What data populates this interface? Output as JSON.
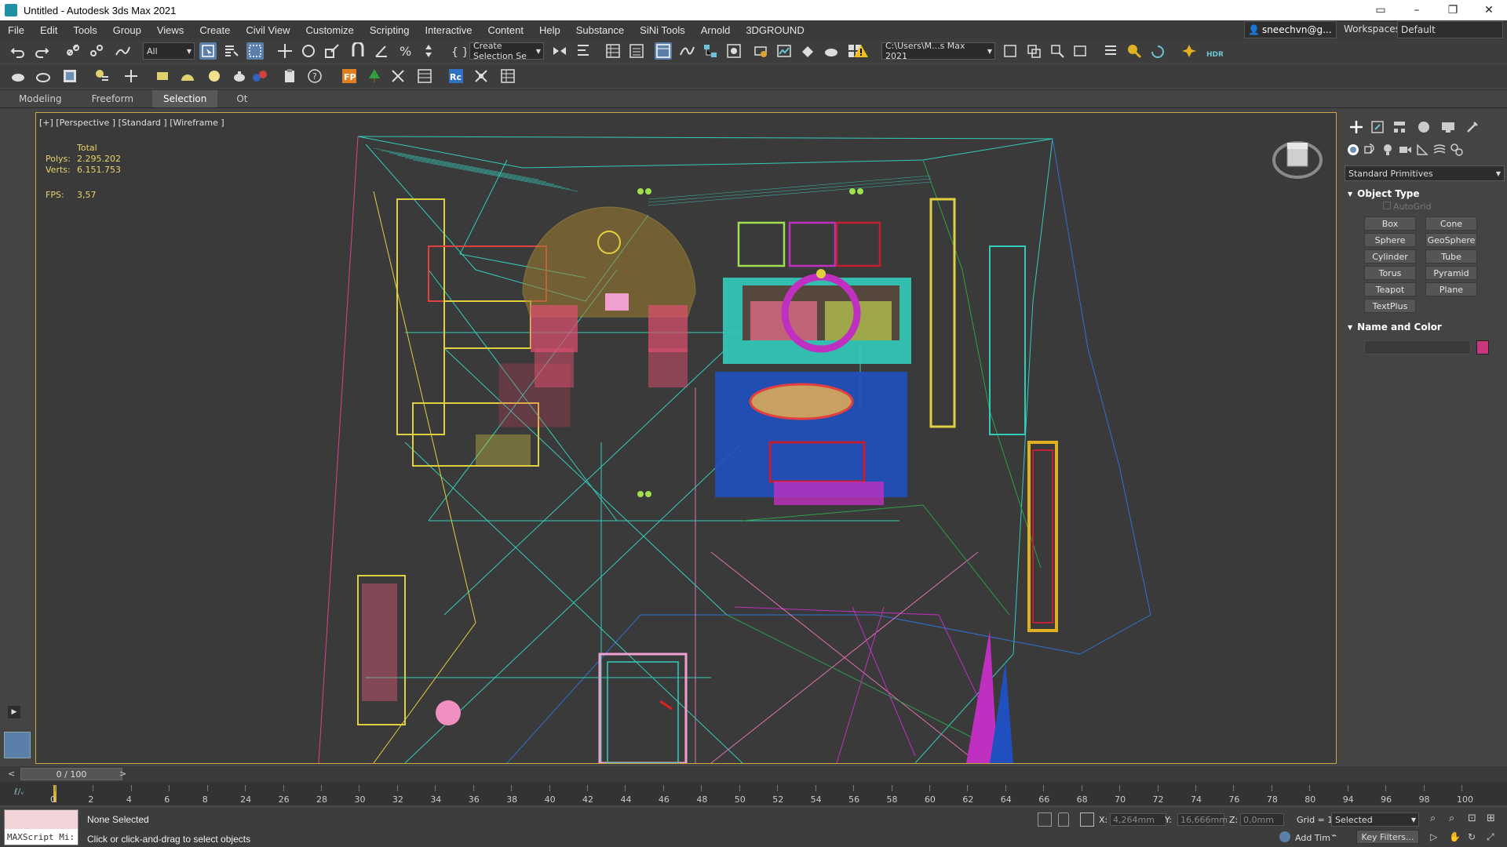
{
  "window": {
    "title": "Untitled - Autodesk 3ds Max 2021"
  },
  "menu": [
    "File",
    "Edit",
    "Tools",
    "Group",
    "Views",
    "Create",
    "Civil View",
    "Customize",
    "Scripting",
    "Interactive",
    "Content",
    "Help",
    "Substance",
    "SiNi Tools",
    "Arnold",
    "3DGROUND"
  ],
  "account": {
    "user": "sneechvn@g...",
    "workspaces_label": "Workspaces:",
    "workspace": "Default"
  },
  "toolbar": {
    "selection_filter": "All",
    "selection_set": "Create Selection Se",
    "project_path": "C:\\Users\\M...s Max 2021"
  },
  "ribbon": {
    "tabs": [
      "Modeling",
      "Freeform",
      "Selection",
      "Ot"
    ],
    "active": "Selection"
  },
  "viewport": {
    "label": "[+] [Perspective ] [Standard ] [Wireframe ]",
    "stats": {
      "header": "Total",
      "polys_label": "Polys:",
      "polys": "2.295.202",
      "verts_label": "Verts:",
      "verts": "6.151.753",
      "fps_label": "FPS:",
      "fps": "3,57"
    }
  },
  "command_panel": {
    "category": "Standard Primitives",
    "object_type_title": "Object Type",
    "autogrid": "AutoGrid",
    "buttons": [
      "Box",
      "Cone",
      "Sphere",
      "GeoSphere",
      "Cylinder",
      "Tube",
      "Torus",
      "Pyramid",
      "Teapot",
      "Plane",
      "TextPlus"
    ],
    "name_color_title": "Name and Color",
    "color": "#c8387a"
  },
  "timeline": {
    "slider": "0 / 100",
    "ticks": [
      "0",
      "2",
      "4",
      "6",
      "8",
      "24",
      "26",
      "28",
      "30",
      "32",
      "34",
      "36",
      "38",
      "40",
      "42",
      "44",
      "46",
      "48",
      "50",
      "52",
      "54",
      "56",
      "58",
      "60",
      "62",
      "64",
      "66",
      "68",
      "70",
      "72",
      "74",
      "76",
      "78",
      "80",
      "94",
      "96",
      "98",
      "100"
    ]
  },
  "status": {
    "maxscript": "MAXScript Mi:",
    "selection": "None Selected",
    "prompt": "Click or click-and-drag to select objects",
    "x_label": "X:",
    "x": "4,264mm",
    "y_label": "Y:",
    "y": "16,666mm",
    "z_label": "Z:",
    "z": "0,0mm",
    "grid": "Grid = 1",
    "selected": "Selected",
    "add_time": "Add Tim",
    "key_filters": "Key Filters..."
  }
}
